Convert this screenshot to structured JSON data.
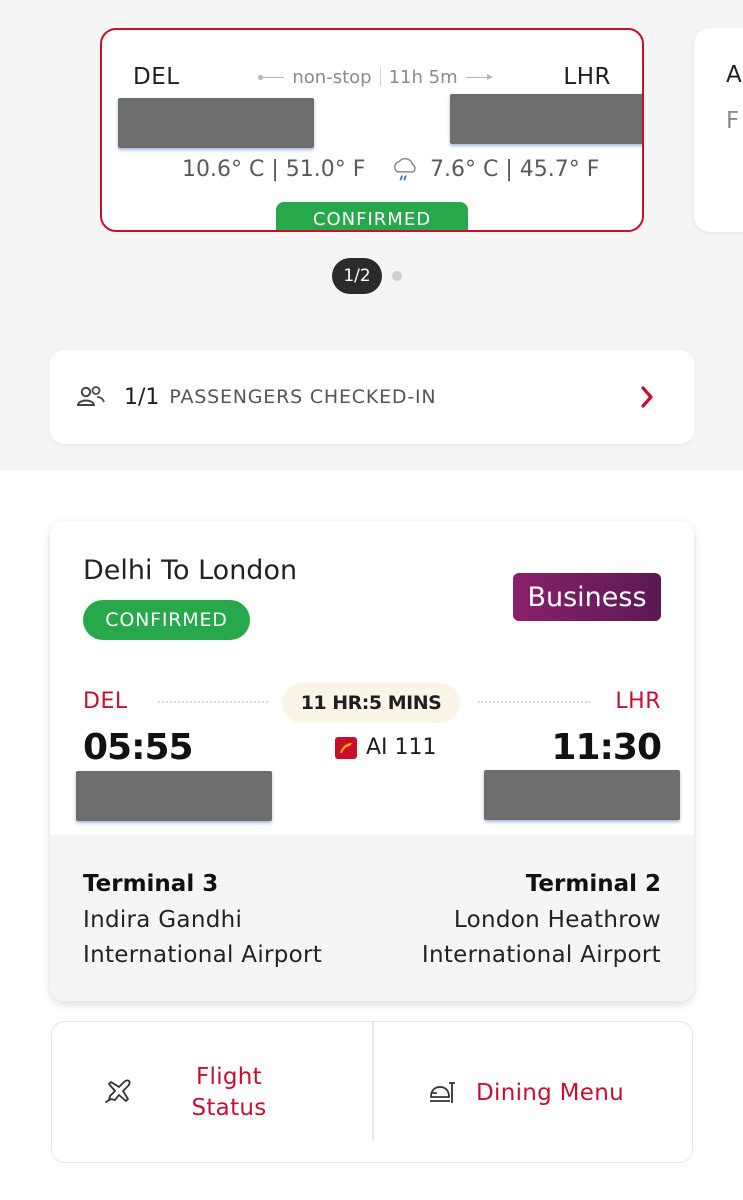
{
  "colors": {
    "brand_red": "#c8102e",
    "confirmed_green": "#27a84a",
    "business_purple": "#7a1c63",
    "page_bg": "#f5f5f5"
  },
  "carousel": {
    "card": {
      "from_code": "DEL",
      "to_code": "LHR",
      "stops": "non-stop",
      "duration": "11h 5m",
      "from_weather_icon": "moon-icon",
      "from_weather": "10.6° C | 51.0° F",
      "to_weather_icon": "rain-cloud-icon",
      "to_weather": "7.6° C | 45.7° F",
      "status": "CONFIRMED"
    },
    "peek_card": {
      "line1": "A",
      "line2": "F"
    },
    "pager": {
      "label": "1/2"
    }
  },
  "checkin": {
    "icon": "passengers-icon",
    "count": "1/1",
    "label": "PASSENGERS CHECKED-IN"
  },
  "flight": {
    "title": "Delhi To London",
    "status": "CONFIRMED",
    "cabin_class": "Business",
    "from_code": "DEL",
    "to_code": "LHR",
    "duration": "11 HR:5 MINS",
    "departure_time": "05:55",
    "arrival_time": "11:30",
    "flight_number": "AI 111",
    "from_terminal": "Terminal 3",
    "from_airport_line1": "Indira Gandhi",
    "from_airport_line2": "International Airport",
    "to_terminal": "Terminal 2",
    "to_airport_line1": "London Heathrow",
    "to_airport_line2": "International Airport"
  },
  "actions": {
    "flight_status_line1": "Flight",
    "flight_status_line2": "Status",
    "dining_menu": "Dining Menu"
  }
}
